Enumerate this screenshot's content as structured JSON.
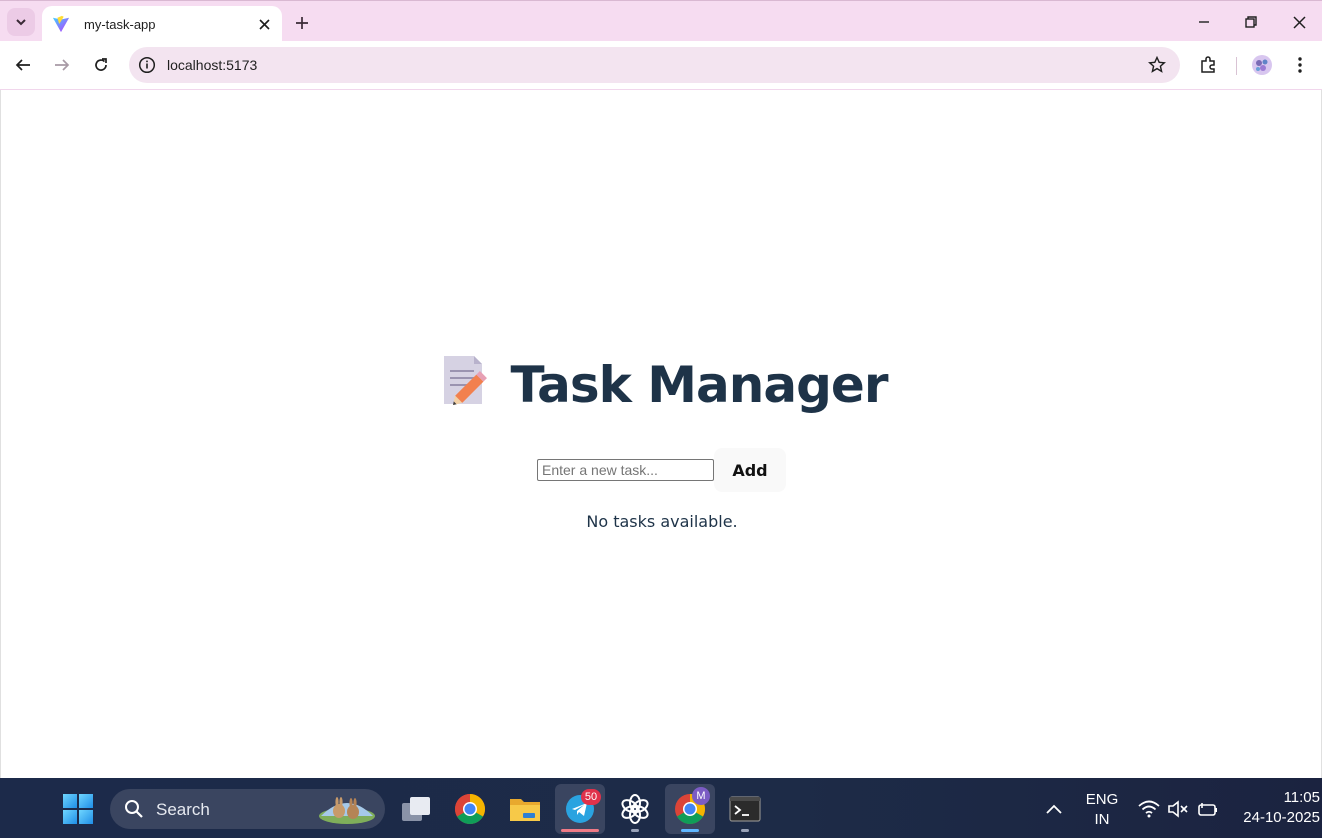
{
  "browser": {
    "tab": {
      "title": "my-task-app",
      "favicon": "vite-logo-icon"
    },
    "address": {
      "url": "localhost:5173"
    },
    "icons": [
      "tab-search-icon",
      "close-icon",
      "plus-icon",
      "minimize-icon",
      "restore-icon",
      "back-icon",
      "forward-icon",
      "reload-icon",
      "info-icon",
      "star-icon",
      "extensions-icon",
      "profile-avatar",
      "menu-kebab-icon"
    ]
  },
  "app": {
    "heading_emoji": "memo-icon",
    "heading": "Task Manager",
    "input": {
      "placeholder": "Enter a new task...",
      "value": ""
    },
    "add_label": "Add",
    "empty_message": "No tasks available."
  },
  "taskbar": {
    "search_label": "Search",
    "telegram_badge": "50",
    "chrome_profile_initial": "M",
    "language": {
      "line1": "ENG",
      "line2": "IN"
    },
    "clock": {
      "time": "11:05",
      "date": "24-10-2025"
    },
    "apps": [
      "start-icon",
      "task-view-icon",
      "chrome-icon",
      "file-explorer-icon",
      "telegram-icon",
      "chatgpt-icon",
      "chrome-profile-icon",
      "terminal-icon"
    ]
  },
  "colors": {
    "chrome_tint": "#f6dcf1",
    "heading": "#1e3348",
    "taskbar": "#1c2a4a"
  }
}
